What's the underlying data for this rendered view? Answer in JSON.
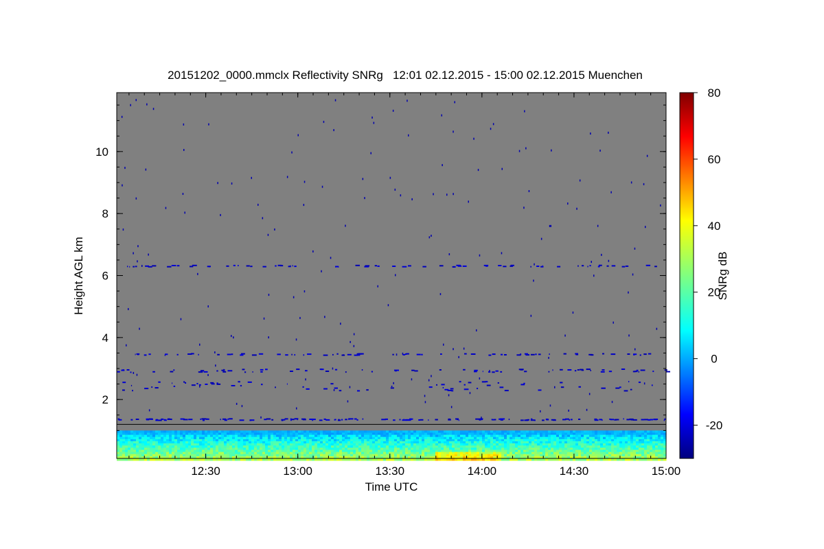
{
  "chart_data": {
    "type": "heatmap",
    "title": "20151202_0000.mmclx Reflectivity SNRg   12:01 02.12.2015 - 15:00 02.12.2015 Muenchen",
    "xlabel": "Time UTC",
    "ylabel": "Height AGL km",
    "colorbar_label": "SNRg dB",
    "x_range": [
      "12:01",
      "15:00"
    ],
    "x_ticks": [
      "12:30",
      "13:00",
      "13:30",
      "14:00",
      "14:30",
      "15:00"
    ],
    "y_range": [
      0.1,
      11.9
    ],
    "y_ticks": [
      2,
      4,
      6,
      8,
      10
    ],
    "color_range": [
      -30,
      80
    ],
    "colorbar_ticks": [
      -20,
      0,
      20,
      40,
      60,
      80
    ],
    "colormap": "jet",
    "background_color": "#808080",
    "cloud_layers": [
      {
        "height_min": 0.1,
        "height_max": 1.0,
        "snr_min": -10,
        "snr_max": 40,
        "description": "near-surface echo"
      },
      {
        "height_min": 1.35,
        "height_max": 1.4,
        "snr_min": -25,
        "snr_max": -20,
        "description": "clutter line"
      },
      {
        "height_min": 2.3,
        "height_max": 2.6,
        "snr_min": -25,
        "snr_max": -20,
        "description": "sparse echoes"
      },
      {
        "height_min": 2.9,
        "height_max": 3.0,
        "snr_min": -25,
        "snr_max": -20,
        "description": "sparse echoes"
      },
      {
        "height_min": 3.45,
        "height_max": 3.5,
        "snr_min": -25,
        "snr_max": -20,
        "description": "sparse echoes"
      },
      {
        "height_min": 6.3,
        "height_max": 6.35,
        "snr_min": -25,
        "snr_max": -20,
        "description": "sparse echoes"
      }
    ],
    "reference_line_height": 1.2
  }
}
